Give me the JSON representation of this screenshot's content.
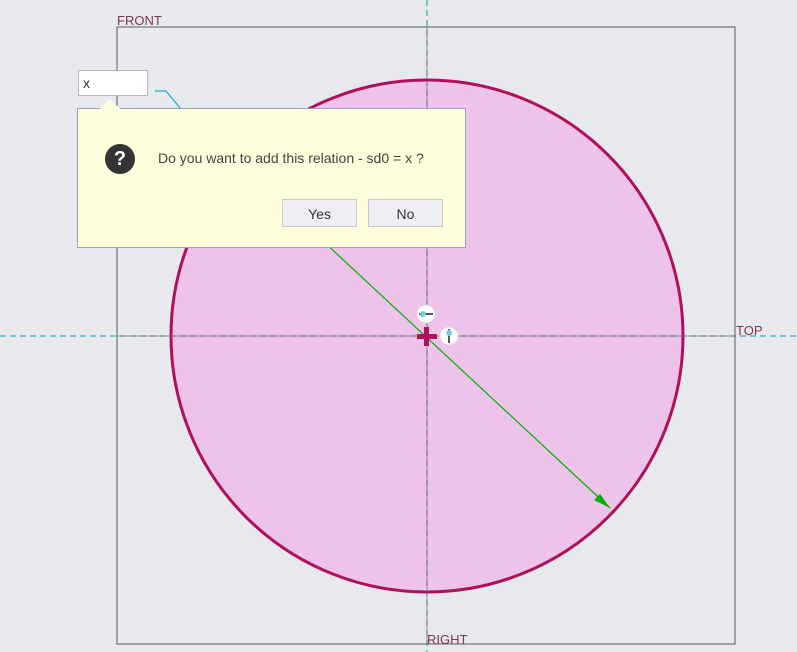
{
  "datums": {
    "front": "FRONT",
    "top": "TOP",
    "right": "RIGHT"
  },
  "dimension_input": {
    "value": "x"
  },
  "dialog": {
    "icon": "question-icon",
    "message": "Do you want to add this relation - sd0 = x ?",
    "yes_label": "Yes",
    "no_label": "No"
  },
  "colors": {
    "circle_fill": "#eec3ea",
    "circle_stroke": "#b0105a",
    "dimension": "#00b000",
    "axis": "#00a0b0"
  }
}
